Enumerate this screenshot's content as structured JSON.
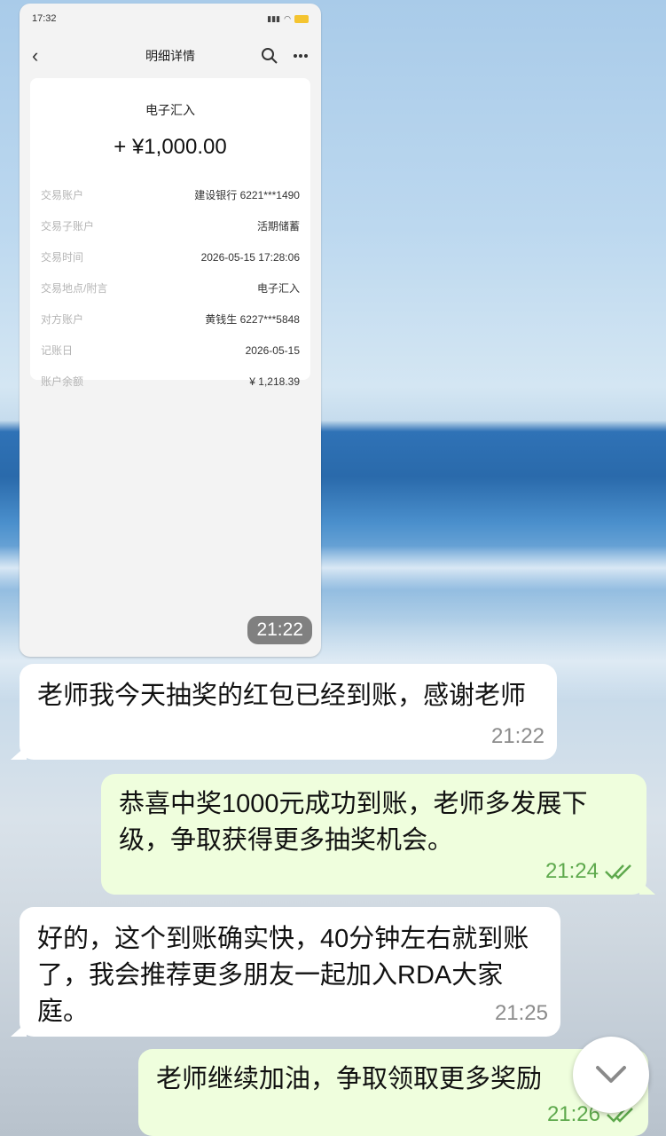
{
  "screenshot": {
    "status_time": "17:32",
    "nav_title": "明细详情",
    "txn_type": "电子汇入",
    "amount": "+ ¥1,000.00",
    "rows": [
      {
        "label": "交易账户",
        "value": "建设银行 6221***1490"
      },
      {
        "label": "交易子账户",
        "value": "活期储蓄"
      },
      {
        "label": "交易时间",
        "value": "2026-05-15 17:28:06"
      },
      {
        "label": "交易地点/附言",
        "value": "电子汇入"
      },
      {
        "label": "对方账户",
        "value": "黄钱生 6227***5848"
      },
      {
        "label": "记账日",
        "value": "2026-05-15"
      },
      {
        "label": "账户余额",
        "value": "¥ 1,218.39"
      }
    ],
    "sent_time": "21:22"
  },
  "messages": [
    {
      "dir": "in",
      "text": "老师我今天抽奖的红包已经到账，感谢老师",
      "time": "21:22"
    },
    {
      "dir": "out",
      "text": "恭喜中奖1000元成功到账，老师多发展下级，争取获得更多抽奖机会。",
      "time": "21:24"
    },
    {
      "dir": "in",
      "text": "好的，这个到账确实快，40分钟左右就到账了，我会推荐更多朋友一起加入RDA大家庭。",
      "time": "21:25"
    },
    {
      "dir": "out",
      "text": "老师继续加油，争取领取更多奖励",
      "time": "21:26"
    }
  ],
  "colors": {
    "outgoing_bubble": "#effedd",
    "incoming_bubble": "#ffffff",
    "read_check": "#5ea94d"
  }
}
